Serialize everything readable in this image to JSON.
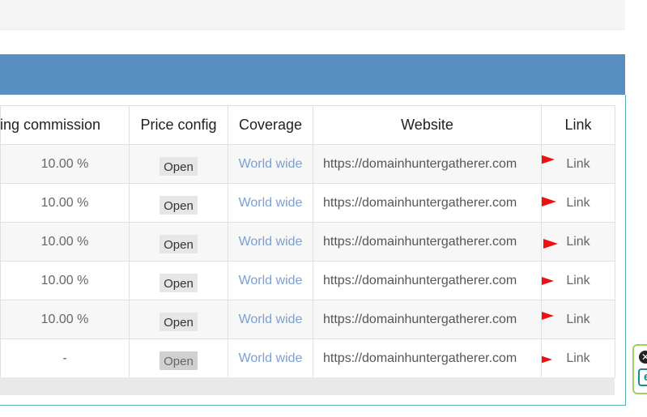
{
  "table": {
    "headers": {
      "commission": "rring commission",
      "price_config": "Price config",
      "coverage": "Coverage",
      "website": "Website",
      "link": "Link"
    },
    "rows": [
      {
        "commission": "10.00 %",
        "price_config": "Open",
        "coverage": "World wide",
        "website": "https://domainhuntergatherer.com",
        "link": "Link"
      },
      {
        "commission": "10.00 %",
        "price_config": "Open",
        "coverage": "World wide",
        "website": "https://domainhuntergatherer.com",
        "link": "Link"
      },
      {
        "commission": "10.00 %",
        "price_config": "Open",
        "coverage": "World wide",
        "website": "https://domainhuntergatherer.com",
        "link": "Link"
      },
      {
        "commission": "10.00 %",
        "price_config": "Open",
        "coverage": "World wide",
        "website": "https://domainhuntergatherer.com",
        "link": "Link"
      },
      {
        "commission": "10.00 %",
        "price_config": "Open",
        "coverage": "World wide",
        "website": "https://domainhuntergatherer.com",
        "link": "Link"
      },
      {
        "commission": "-",
        "price_config": "Open",
        "coverage": "World wide",
        "website": "https://domainhuntergatherer.com",
        "link": "Link"
      }
    ]
  },
  "side_widget": {
    "close_glyph": "✕",
    "e_glyph": "e"
  },
  "colors": {
    "header_bar": "#588fc0",
    "link_text": "#7c9fcf",
    "flag": "#ee1111",
    "frame": "#59b0ac"
  }
}
